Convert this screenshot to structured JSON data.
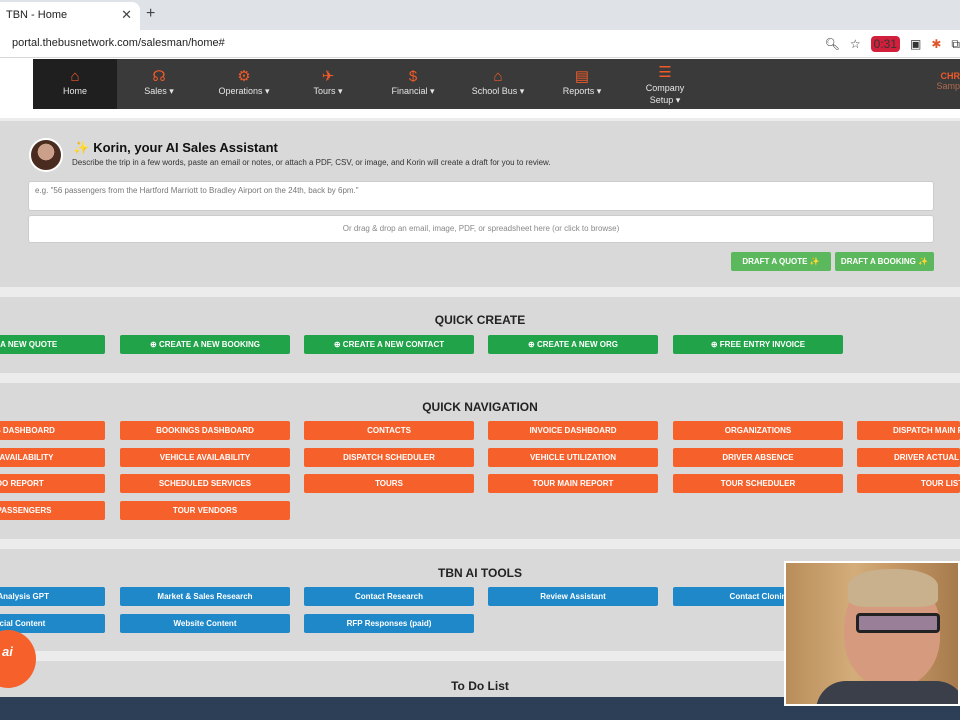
{
  "browser": {
    "tab_title": "TBN - Home",
    "url": "portal.thebusnetwork.com/salesman/home#",
    "rec_badge": "0:31"
  },
  "nav": {
    "items": [
      {
        "label": "Home",
        "icon": "home-icon"
      },
      {
        "label": "Sales ▾",
        "icon": "headset-icon"
      },
      {
        "label": "Operations ▾",
        "icon": "gears-icon"
      },
      {
        "label": "Tours ▾",
        "icon": "plane-icon"
      },
      {
        "label": "Financial ▾",
        "icon": "dollar-icon"
      },
      {
        "label": "School Bus ▾",
        "icon": "school-icon"
      },
      {
        "label": "Reports ▾",
        "icon": "report-icon"
      },
      {
        "label": "Company Setup ▾",
        "icon": "sliders-icon"
      }
    ],
    "user_short": "CHR",
    "user_sub": "Samp"
  },
  "korin": {
    "title": "Korin, your AI Sales Assistant",
    "description": "Describe the trip in a few words, paste an email or notes, or attach a PDF, CSV, or image, and Korin will create a draft for you to review.",
    "input_placeholder": "e.g. \"56 passengers from the Hartford Marriott to Bradley Airport on the 24th, back by 6pm.\"",
    "drop_text": "Or drag & drop an email, image, PDF, or spreadsheet here (or click to browse)",
    "draft_quote": "DRAFT A QUOTE ✨",
    "draft_booking": "DRAFT A BOOKING ✨"
  },
  "quick_create": {
    "title": "QUICK CREATE",
    "buttons": [
      "ATE A NEW QUOTE",
      "⊕ CREATE A NEW BOOKING",
      "⊕ CREATE A NEW CONTACT",
      "⊕ CREATE A NEW ORG",
      "⊕ FREE ENTRY INVOICE"
    ]
  },
  "quick_nav": {
    "title": "QUICK NAVIGATION",
    "row1": [
      "TES DASHBOARD",
      "BOOKINGS DASHBOARD",
      "CONTACTS",
      "INVOICE DASHBOARD",
      "ORGANIZATIONS",
      "DISPATCH MAIN R"
    ],
    "row2": [
      "ER AVAILABILITY",
      "VEHICLE AVAILABILITY",
      "DISPATCH SCHEDULER",
      "VEHICLE UTILIZATION",
      "DRIVER ABSENCE",
      "DRIVER ACTUAL"
    ],
    "row3": [
      "DO REPORT",
      "SCHEDULED SERVICES",
      "TOURS",
      "TOUR MAIN REPORT",
      "TOUR SCHEDULER",
      "TOUR LIST"
    ],
    "row4": [
      "R PASSENGERS",
      "TOUR VENDORS"
    ]
  },
  "ai_tools": {
    "title": "TBN AI TOOLS",
    "row1": [
      "a Analysis GPT",
      "Market & Sales Research",
      "Contact Research",
      "Review Assistant",
      "Contact Clonin"
    ],
    "row2": [
      "ocial Content",
      "Website Content",
      "RFP Responses (paid)"
    ]
  },
  "todo": {
    "title": "To Do List"
  },
  "cloud_text": "ai",
  "colors": {
    "orange": "#f5602b",
    "green": "#21a34a",
    "blue": "#1e88c9",
    "nav_bg": "#3a3a3a"
  }
}
